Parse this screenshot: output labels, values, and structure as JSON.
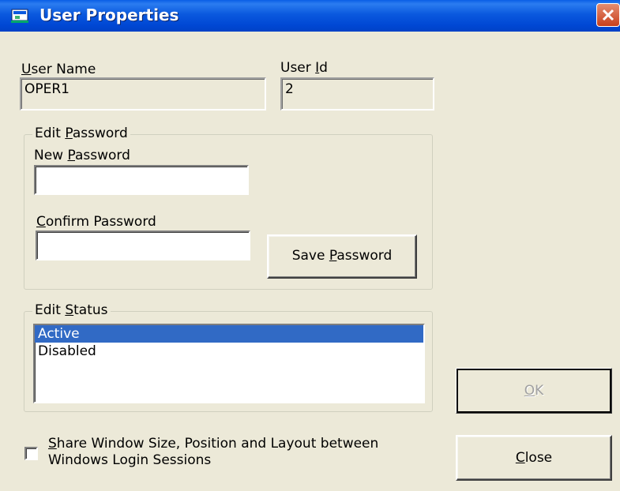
{
  "window": {
    "title": "User Properties",
    "close_icon": "close-x-icon",
    "app_icon": "user-properties-icon"
  },
  "user_name": {
    "label_accel": "U",
    "label_rest": "ser Name",
    "value": "OPER1"
  },
  "user_id": {
    "label_pre": "User ",
    "label_accel": "I",
    "label_rest": "d",
    "value": "2"
  },
  "edit_password": {
    "title_pre": "Edit ",
    "title_accel": "P",
    "title_rest": "assword",
    "new_password": {
      "label_pre": "New ",
      "label_accel": "P",
      "label_rest": "assword",
      "value": ""
    },
    "confirm_password": {
      "label_accel": "C",
      "label_rest": "onfirm Password",
      "value": ""
    },
    "save_button": {
      "label_pre": "Save ",
      "label_accel": "P",
      "label_rest": "assword"
    }
  },
  "edit_status": {
    "title_pre": "Edit ",
    "title_accel": "S",
    "title_rest": "tatus",
    "options": [
      "Active",
      "Disabled"
    ],
    "selected": "Active"
  },
  "share_checkbox": {
    "label_line1_accel": "S",
    "label_line1_rest": "hare Window Size, Position and Layout between",
    "label_line2": "Windows Login Sessions",
    "checked": false
  },
  "buttons": {
    "ok_accel": "O",
    "ok_rest": "K",
    "ok_enabled": false,
    "close_accel": "C",
    "close_rest": "lose"
  },
  "colors": {
    "titlebar": "#0a59de",
    "dialog_bg": "#ece9d8",
    "selection": "#316ac5",
    "close_button": "#c8401c"
  }
}
